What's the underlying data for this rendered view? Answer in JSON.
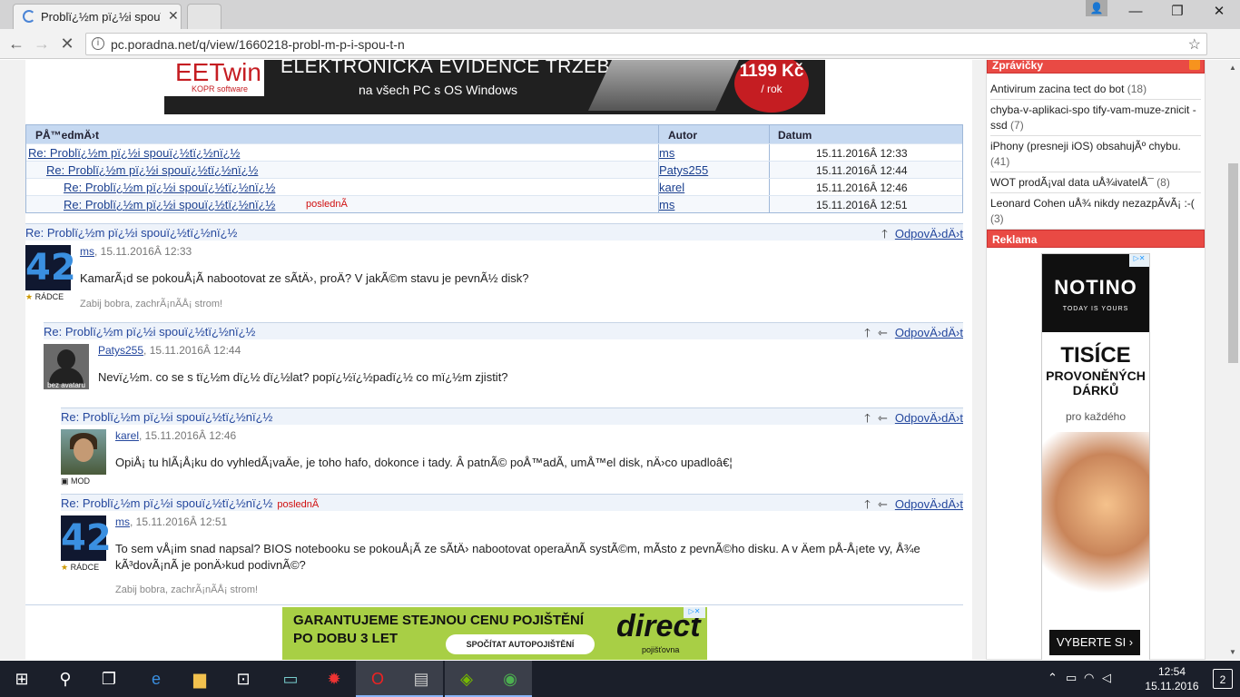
{
  "browser": {
    "tab_title": "Problï¿½m pï¿½i spouï¿½",
    "url": "pc.poradna.net/q/view/1660218-probl-m-p-i-spou-t-n"
  },
  "banner": {
    "logo": "EETwin",
    "logo_sub": "KOPR software",
    "headline": "ELEKTRONICKÁ EVIDENCE TRŽEB",
    "sub": "na všech PC s OS Windows",
    "price": "1199 Kč",
    "price_unit": "/ rok"
  },
  "thread_table": {
    "headers": [
      "PÅ™edmÄ›t",
      "Autor",
      "Datum"
    ],
    "rows": [
      {
        "subject": "Re: Problï¿½m pï¿½i spouï¿½tï¿½nï¿½",
        "author": "ms",
        "date": "15.11.2016Â 12:33",
        "last": ""
      },
      {
        "subject": "Re: Problï¿½m pï¿½i spouï¿½tï¿½nï¿½",
        "author": "Patys255",
        "date": "15.11.2016Â 12:44",
        "last": ""
      },
      {
        "subject": "Re: Problï¿½m pï¿½i spouï¿½tï¿½nï¿½",
        "author": "karel",
        "date": "15.11.2016Â 12:46",
        "last": ""
      },
      {
        "subject": "Re: Problï¿½m pï¿½i spouï¿½tï¿½nï¿½",
        "author": "ms",
        "date": "15.11.2016Â 12:51",
        "last": "poslednÃ"
      }
    ]
  },
  "posts": [
    {
      "title": "Re: Problï¿½m pï¿½i spouï¿½tï¿½nï¿½",
      "reply": "OdpovÄ›dÄ›t",
      "author": "ms",
      "date": ", 15.11.2016Â 12:33",
      "rank": "RÁDCE",
      "body": "KamarÃ¡d se pokouÅ¡Ã­ nabootovat ze sÃ­tÄ›, proÄ? V jakÃ©m stavu je pevnÃ½ disk?",
      "sig": "Zabij bobra, zachrÃ¡nÃ­Å¡ strom!",
      "last": ""
    },
    {
      "title": "Re: Problï¿½m pï¿½i spouï¿½tï¿½nï¿½",
      "reply": "OdpovÄ›dÄ›t",
      "author": "Patys255",
      "date": ", 15.11.2016Â 12:44",
      "rank": "bez avataru",
      "body": "Nevï¿½m. co se s tï¿½m dï¿½ dï¿½lat? popï¿½ï¿½padï¿½ co mï¿½m zjistit?",
      "sig": "",
      "last": ""
    },
    {
      "title": "Re: Problï¿½m pï¿½i spouï¿½tï¿½nï¿½",
      "reply": "OdpovÄ›dÄ›t",
      "author": "karel",
      "date": ", 15.11.2016Â 12:46",
      "rank": "MOD",
      "body": "OpiÅ¡ tu hlÃ¡Å¡ku do vyhledÃ¡vaÄe, je toho hafo, dokonce i tady. Â patnÃ© poÅ™adÃ, umÅ™el disk, nÄ›co upadloâ€¦",
      "sig": "",
      "last": ""
    },
    {
      "title": "Re: Problï¿½m pï¿½i spouï¿½tï¿½nï¿½",
      "reply": "OdpovÄ›dÄ›t",
      "author": "ms",
      "date": ", 15.11.2016Â 12:51",
      "rank": "RÁDCE",
      "body": "To sem vÅ¡im snad napsal? BIOS notebooku se pokouÅ¡Ã­ ze sÃ­tÄ› nabootovat operaÄnÃ systÃ©m, mÃ­sto z pevnÃ©ho disku. A v Äem pÅ-Å¡ete vy, Å¾e kÃ³dovÃ¡nÃ je ponÄ›kud podivnÃ©?",
      "sig": "Zabij bobra, zachrÃ¡nÃ­Å¡ strom!",
      "last": "poslednÃ"
    }
  ],
  "bottom_ad": {
    "line1": "GARANTUJEME STEJNOU CENU POJIŠTĚNÍ",
    "line2": "PO DOBU 3 LET",
    "button": "SPOČÍTAT AUTOPOJIŠTĚNÍ",
    "brand": "direct",
    "brand_sub": "pojišťovna"
  },
  "sidebar": {
    "news_title": "Zprávičky",
    "news": [
      {
        "text": "Antivirum zacina tect do bot",
        "count": "(18)"
      },
      {
        "text": "chyba-v-aplikaci-spo tify-vam-muze-znicit -ssd",
        "count": "(7)"
      },
      {
        "text": "iPhony (presneji iOS) obsahujÃº chybu.",
        "count": "(41)"
      },
      {
        "text": "WOT prodÃ¡val data uÅ¾ivatelÅ¯",
        "count": "(8)"
      },
      {
        "text": "Leonard Cohen uÅ¾ nikdy nezazpÃ­vÃ¡ :-(",
        "count": "(3)"
      }
    ],
    "ads_title": "Reklama",
    "notino": {
      "brand": "NOTINO",
      "tagline": "TODAY IS YOURS",
      "big": "TISÍCE",
      "mid1": "PROVONĚNÝCH",
      "mid2": "DÁRKŮ",
      "pk": "pro každého",
      "cta": "VYBERTE SI"
    }
  },
  "taskbar": {
    "time": "12:54",
    "date": "15.11.2016",
    "notifications": "2"
  }
}
